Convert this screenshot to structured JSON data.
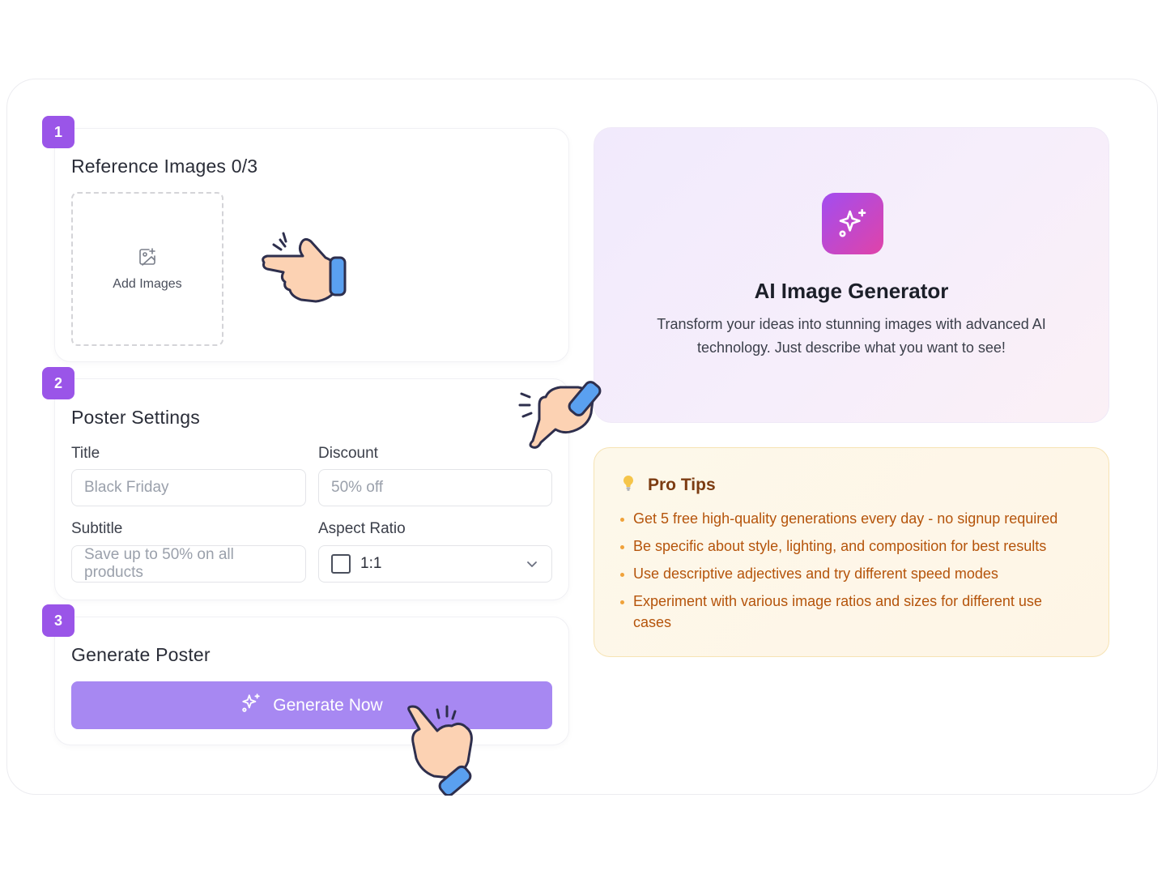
{
  "steps": {
    "one": {
      "number": "1",
      "title": "Reference Images 0/3",
      "upload_label": "Add Images"
    },
    "two": {
      "number": "2",
      "title": "Poster Settings",
      "title_label": "Title",
      "title_placeholder": "Black Friday",
      "discount_label": "Discount",
      "discount_placeholder": "50% off",
      "subtitle_label": "Subtitle",
      "subtitle_placeholder": "Save up to 50% on all products",
      "aspect_label": "Aspect Ratio",
      "aspect_value": "1:1"
    },
    "three": {
      "number": "3",
      "title": "Generate Poster",
      "button_label": "Generate Now"
    }
  },
  "hero": {
    "icon": "sparkles-icon",
    "title": "AI Image Generator",
    "description": "Transform your ideas into stunning images with advanced AI technology. Just describe what you want to see!"
  },
  "tips": {
    "icon": "lightbulb-icon",
    "title": "Pro Tips",
    "items": [
      "Get 5 free high-quality generations every day - no signup required",
      "Be specific about style, lighting, and composition for best results",
      "Use descriptive adjectives and try different speed modes",
      "Experiment with various image ratios and sizes for different use cases"
    ]
  },
  "colors": {
    "accent": "#9a55e8",
    "button": "#a788f2",
    "tips_text": "#b5540b",
    "tips_title": "#7c3c12"
  },
  "decorations": [
    "pointing-hand-icon",
    "pointing-hand-icon",
    "pointing-hand-icon"
  ]
}
